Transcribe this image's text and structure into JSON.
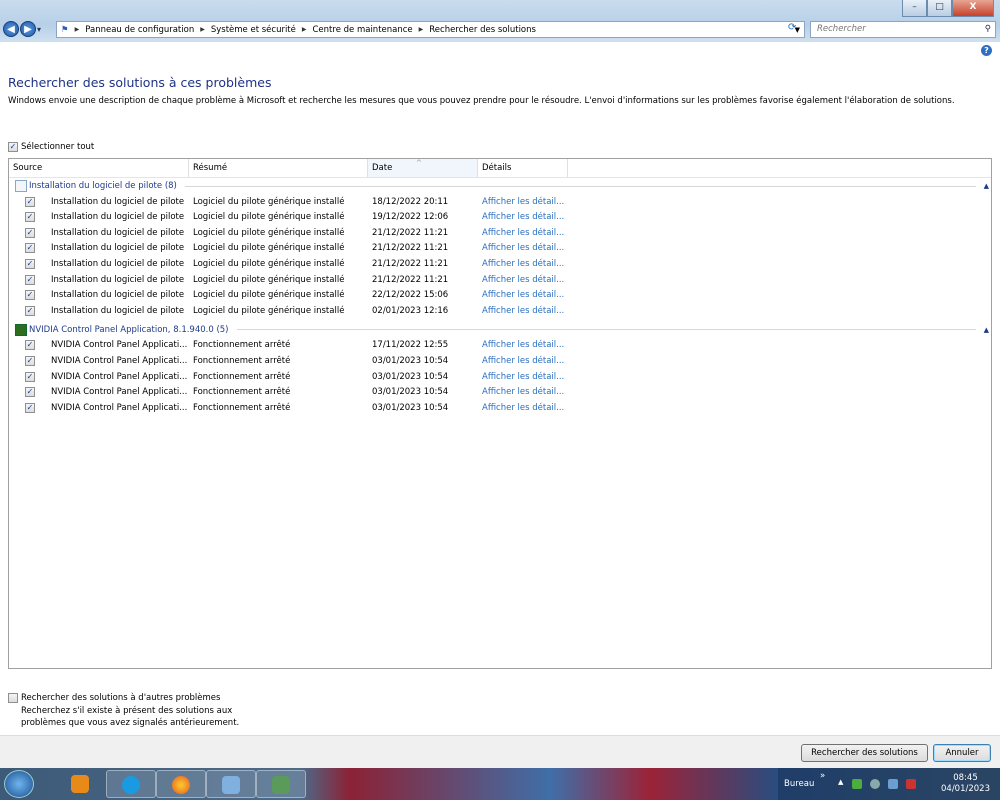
{
  "window": {
    "minimize": "–",
    "maximize": "□",
    "close": "X"
  },
  "nav": {
    "back": "◀",
    "forward": "▶",
    "history": "▾"
  },
  "breadcrumb": [
    "Panneau de configuration",
    "Système et sécurité",
    "Centre de maintenance",
    "Rechercher des solutions"
  ],
  "search": {
    "placeholder": "Rechercher"
  },
  "page": {
    "title": "Rechercher des solutions à ces problèmes",
    "description": "Windows envoie une description de chaque problème à Microsoft et recherche les mesures que vous pouvez prendre pour le résoudre. L'envoi d'informations sur les problèmes favorise également l'élaboration de solutions.",
    "select_all": "Sélectionner tout",
    "select_all_checked": true
  },
  "table": {
    "columns": [
      "Source",
      "Résumé",
      "Date",
      "Détails"
    ],
    "sorted_column": "Date",
    "groups": [
      {
        "title": "Installation du logiciel de pilote (8)",
        "icon": "document-icon",
        "rows": [
          {
            "source": "Installation du logiciel de pilote",
            "summary": "Logiciel du pilote générique installé",
            "date": "18/12/2022 20:11",
            "details": "Afficher les détail..."
          },
          {
            "source": "Installation du logiciel de pilote",
            "summary": "Logiciel du pilote générique installé",
            "date": "19/12/2022 12:06",
            "details": "Afficher les détail..."
          },
          {
            "source": "Installation du logiciel de pilote",
            "summary": "Logiciel du pilote générique installé",
            "date": "21/12/2022 11:21",
            "details": "Afficher les détail..."
          },
          {
            "source": "Installation du logiciel de pilote",
            "summary": "Logiciel du pilote générique installé",
            "date": "21/12/2022 11:21",
            "details": "Afficher les détail..."
          },
          {
            "source": "Installation du logiciel de pilote",
            "summary": "Logiciel du pilote générique installé",
            "date": "21/12/2022 11:21",
            "details": "Afficher les détail..."
          },
          {
            "source": "Installation du logiciel de pilote",
            "summary": "Logiciel du pilote générique installé",
            "date": "21/12/2022 11:21",
            "details": "Afficher les détail..."
          },
          {
            "source": "Installation du logiciel de pilote",
            "summary": "Logiciel du pilote générique installé",
            "date": "22/12/2022 15:06",
            "details": "Afficher les détail..."
          },
          {
            "source": "Installation du logiciel de pilote",
            "summary": "Logiciel du pilote générique installé",
            "date": "02/01/2023 12:16",
            "details": "Afficher les détail..."
          }
        ]
      },
      {
        "title": "NVIDIA Control Panel Application, 8.1.940.0 (5)",
        "icon": "nvidia-icon",
        "rows": [
          {
            "source": "NVIDIA Control Panel Applicati...",
            "summary": "Fonctionnement arrêté",
            "date": "17/11/2022 12:55",
            "details": "Afficher les détail..."
          },
          {
            "source": "NVIDIA Control Panel Applicati...",
            "summary": "Fonctionnement arrêté",
            "date": "03/01/2023 10:54",
            "details": "Afficher les détail..."
          },
          {
            "source": "NVIDIA Control Panel Applicati...",
            "summary": "Fonctionnement arrêté",
            "date": "03/01/2023 10:54",
            "details": "Afficher les détail..."
          },
          {
            "source": "NVIDIA Control Panel Applicati...",
            "summary": "Fonctionnement arrêté",
            "date": "03/01/2023 10:54",
            "details": "Afficher les détail..."
          },
          {
            "source": "NVIDIA Control Panel Applicati...",
            "summary": "Fonctionnement arrêté",
            "date": "03/01/2023 10:54",
            "details": "Afficher les détail..."
          }
        ]
      }
    ]
  },
  "other": {
    "label": "Rechercher des solutions à d'autres problèmes",
    "checked": false,
    "sub1": "Recherchez s'il existe à présent des solutions aux",
    "sub2": "problèmes que vous avez signalés antérieurement."
  },
  "buttons": {
    "search": "Rechercher des solutions",
    "cancel": "Annuler"
  },
  "taskbar": {
    "desktop": "Bureau",
    "chevron": "»",
    "time": "08:45",
    "date": "04/01/2023"
  },
  "colors": {
    "link": "#2a6fc0",
    "title": "#1e3287"
  }
}
